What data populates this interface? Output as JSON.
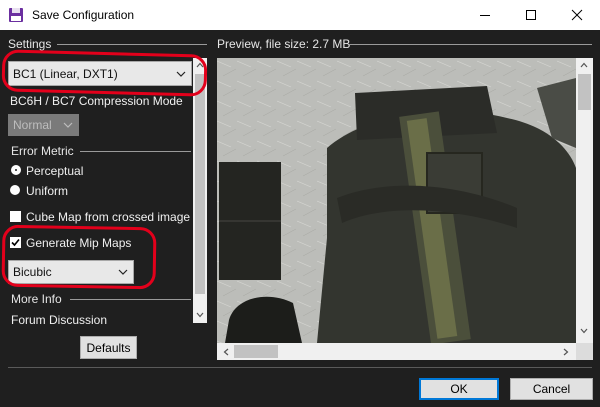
{
  "window": {
    "title": "Save Configuration",
    "minimize_icon": "minimize-icon",
    "maximize_icon": "maximize-icon",
    "close_icon": "close-icon"
  },
  "settings": {
    "section_label": "Settings",
    "format_select": {
      "value": "BC1 (Linear, DXT1)"
    },
    "bc6h_label": "BC6H / BC7 Compression Mode",
    "bc6h_select": {
      "value": "Normal"
    },
    "error_metric": {
      "label": "Error Metric",
      "options": [
        {
          "label": "Perceptual",
          "checked": true
        },
        {
          "label": "Uniform",
          "checked": false
        }
      ]
    },
    "cube_map": {
      "label": "Cube Map from crossed image",
      "checked": false
    },
    "generate_mips": {
      "label": "Generate Mip Maps",
      "checked": true
    },
    "mip_filter_select": {
      "value": "Bicubic"
    },
    "more_info": {
      "label": "More Info",
      "link": "Forum Discussion"
    },
    "defaults_button": "Defaults"
  },
  "preview": {
    "label": "Preview, file size: 2.7 MB"
  },
  "footer": {
    "ok_button": "OK",
    "cancel_button": "Cancel"
  },
  "colors": {
    "annotation": "#e3001b",
    "background": "#1f1f1f"
  }
}
